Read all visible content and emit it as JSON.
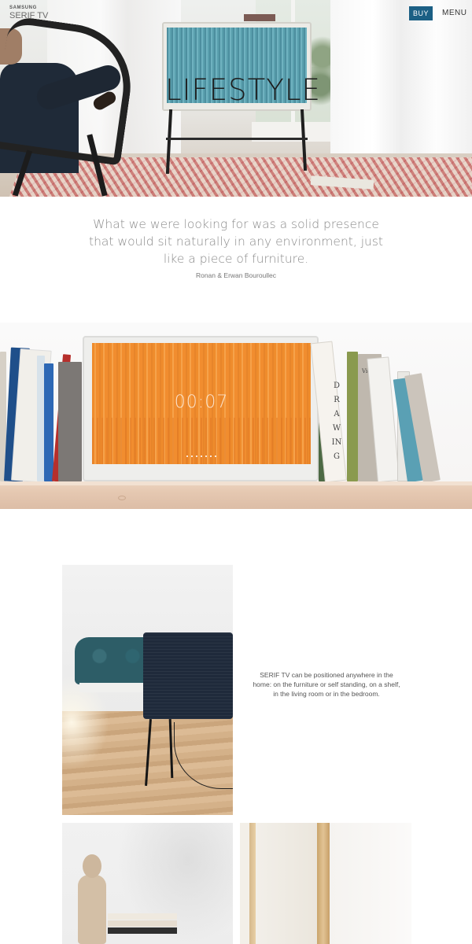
{
  "header": {
    "brand_top": "SAMSUNG",
    "brand_name": "SERIF TV",
    "buy_label": "BUY",
    "menu_label": "MENU",
    "accent_color": "#1b5f84"
  },
  "hero": {
    "title": "LIFESTYLE"
  },
  "quote": {
    "text": "What we were looking for was a solid presence that would sit naturally in any environment, just like a piece of furniture.",
    "author": "Ronan & Erwan Bouroullec"
  },
  "shelf_tv": {
    "time": "00:07",
    "book_spine_drawing": "DRAWING",
    "book_spine_video": "Video"
  },
  "placement": {
    "description": "SERIF TV can be positioned anywhere in the home: on the furniture or self standing, on a shelf, in the living room or in the bedroom."
  }
}
